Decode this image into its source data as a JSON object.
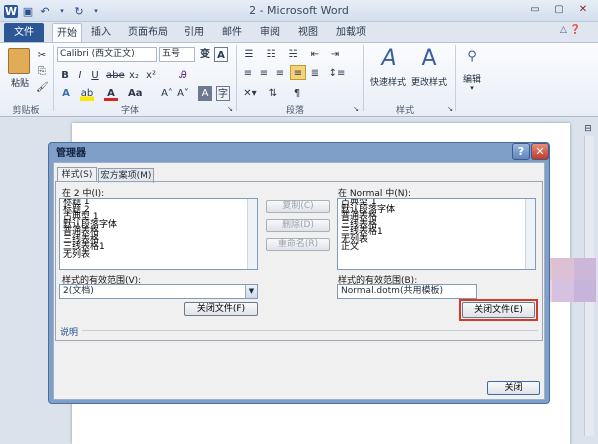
{
  "window": {
    "title": "2 - Microsoft Word",
    "icon": "word-icon",
    "controls": [
      "minimize-icon",
      "maximize-icon",
      "close-icon"
    ]
  },
  "ribbon": {
    "tabs": [
      {
        "label": "文件",
        "active": false
      },
      {
        "label": "开始",
        "active": true
      },
      {
        "label": "插入",
        "active": false
      },
      {
        "label": "页面布局",
        "active": false
      },
      {
        "label": "引用",
        "active": false
      },
      {
        "label": "邮件",
        "active": false
      },
      {
        "label": "审阅",
        "active": false
      },
      {
        "label": "视图",
        "active": false
      },
      {
        "label": "加载项",
        "active": false
      }
    ],
    "clipboard": {
      "paste_label": "粘贴",
      "group_label": "剪贴板"
    },
    "font": {
      "name": "Calibri (西文正文)",
      "size": "五号",
      "group_label": "字体",
      "big_a": "A",
      "wen": "A"
    },
    "paragraph": {
      "group_label": "段落"
    },
    "styles": {
      "quick_label": "快速样式",
      "change_label": "更改样式",
      "group_label": "样式"
    },
    "editing": {
      "label": "编辑"
    }
  },
  "dialog": {
    "title": "管理器",
    "help_glyph": "?",
    "close_glyph": "✕",
    "tabs": [
      {
        "label": "样式(S)",
        "active": true
      },
      {
        "label": "宏方案项(M)",
        "active": false
      }
    ],
    "left": {
      "label": "在 2 中(I):",
      "items": [
        "标题 1",
        "标题 2",
        "古典型 1",
        "默认段落字体",
        "普通表格",
        "三线表格",
        "三线表格1",
        "无列表"
      ],
      "range_label": "样式的有效范围(V):",
      "range_value": "2(文档)",
      "close_file": "关闭文件(F)"
    },
    "middle": {
      "copy": "复制(C)",
      "delete": "删除(D)",
      "rename": "重命名(R)"
    },
    "right": {
      "label": "在 Normal 中(N):",
      "items": [
        "古典型 1",
        "默认段落字体",
        "普通表格",
        "三线表格",
        "三线表格1",
        "无列表",
        "正文"
      ],
      "range_label": "样式的有效范围(B):",
      "range_value": "Normal.dotm(共用模板)",
      "close_file": "关闭文件(E)"
    },
    "description_label": "说明",
    "close_button": "关闭"
  }
}
